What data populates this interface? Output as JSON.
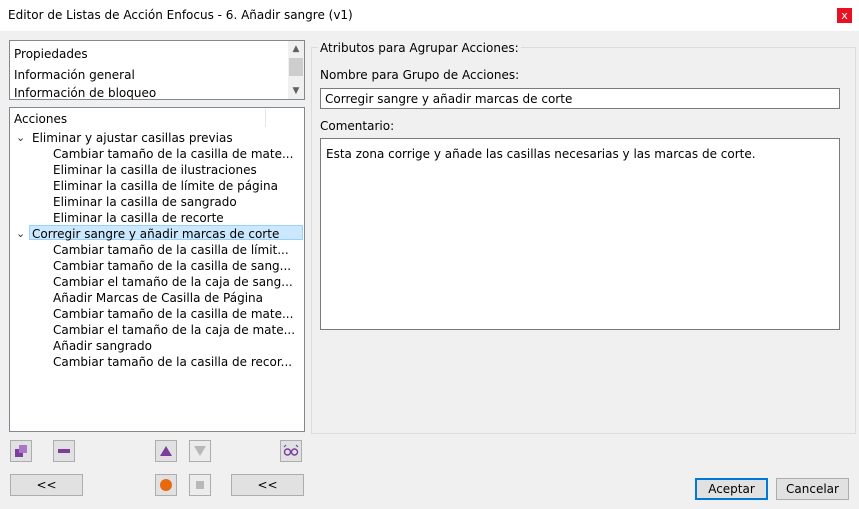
{
  "window": {
    "title": "Editor de Listas de Acción Enfocus - 6. Añadir sangre (v1)",
    "close_glyph": "x"
  },
  "properties_list": {
    "items": [
      "Propiedades",
      "Información general",
      "Información de bloqueo"
    ]
  },
  "actions_list": {
    "header": "Acciones",
    "groups": [
      {
        "label": "Eliminar y ajustar casillas previas",
        "expanded": true,
        "children": [
          "Cambiar tamaño de la casilla de mate...",
          "Eliminar la casilla de ilustraciones",
          "Eliminar la casilla de límite de página",
          "Eliminar la casilla de sangrado",
          "Eliminar la casilla de recorte"
        ]
      },
      {
        "label": "Corregir sangre y añadir marcas de corte",
        "expanded": true,
        "selected": true,
        "children": [
          "Cambiar tamaño de la casilla de límit...",
          "Cambiar tamaño de la casilla de sang...",
          "Cambiar el tamaño de la caja de sang...",
          "Añadir Marcas de Casilla de Página",
          "Cambiar tamaño de la casilla de mate...",
          "Cambiar el tamaño de la caja de mate...",
          "Añadir sangrado",
          "Cambiar tamaño de la casilla de recor..."
        ]
      }
    ]
  },
  "toolbar": {
    "collapse_left_label": "<<",
    "collapse_right_label": "<<"
  },
  "details": {
    "group_title": "Atributos para Agrupar Acciones:",
    "name_label": "Nombre para Grupo de Acciones:",
    "name_value": "Corregir sangre y añadir marcas de corte",
    "comment_label": "Comentario:",
    "comment_value": "Esta zona corrige y añade las casillas necesarias y las marcas de corte."
  },
  "footer": {
    "accept_label": "Aceptar",
    "cancel_label": "Cancelar"
  },
  "colors": {
    "accent": "#0078d7",
    "selection": "#cce8ff",
    "icon_purple": "#7a3e9d",
    "record_orange": "#e86a10"
  }
}
